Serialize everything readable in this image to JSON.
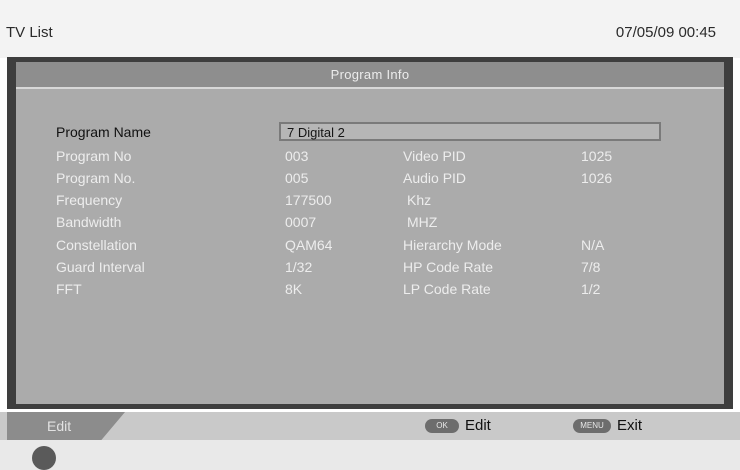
{
  "header": {
    "title": "TV List",
    "datetime": "07/05/09  00:45"
  },
  "panel": {
    "title": "Program Info"
  },
  "program": {
    "name_label": "Program Name",
    "name_value": "7  Digital  2",
    "rows": [
      {
        "label": "Program No",
        "value": "003",
        "label2": "Video PID",
        "value2": "1025"
      },
      {
        "label": "Program No.",
        "value": "005",
        "label2": "Audio PID",
        "value2": "1026"
      },
      {
        "label": "Frequency",
        "value": "177500",
        "label2": "Khz",
        "value2": ""
      },
      {
        "label": "Bandwidth",
        "value": "0007",
        "label2": "MHZ",
        "value2": ""
      },
      {
        "label": "Constellation",
        "value": "QAM64",
        "label2": "Hierarchy Mode",
        "value2": "N/A"
      },
      {
        "label": "Guard Interval",
        "value": "1/32",
        "label2": "HP Code Rate",
        "value2": "7/8"
      },
      {
        "label": "FFT",
        "value": "8K",
        "label2": "LP  Code Rate",
        "value2": "1/2"
      }
    ]
  },
  "footer": {
    "tab_label": "Edit",
    "ok_key": "OK",
    "ok_label": "Edit",
    "menu_key": "MENU",
    "menu_label": "Exit"
  },
  "colors": {
    "panel_border": "#3e3e3e",
    "panel_bg": "#ababab",
    "header_bg": "#8e8e8e"
  }
}
